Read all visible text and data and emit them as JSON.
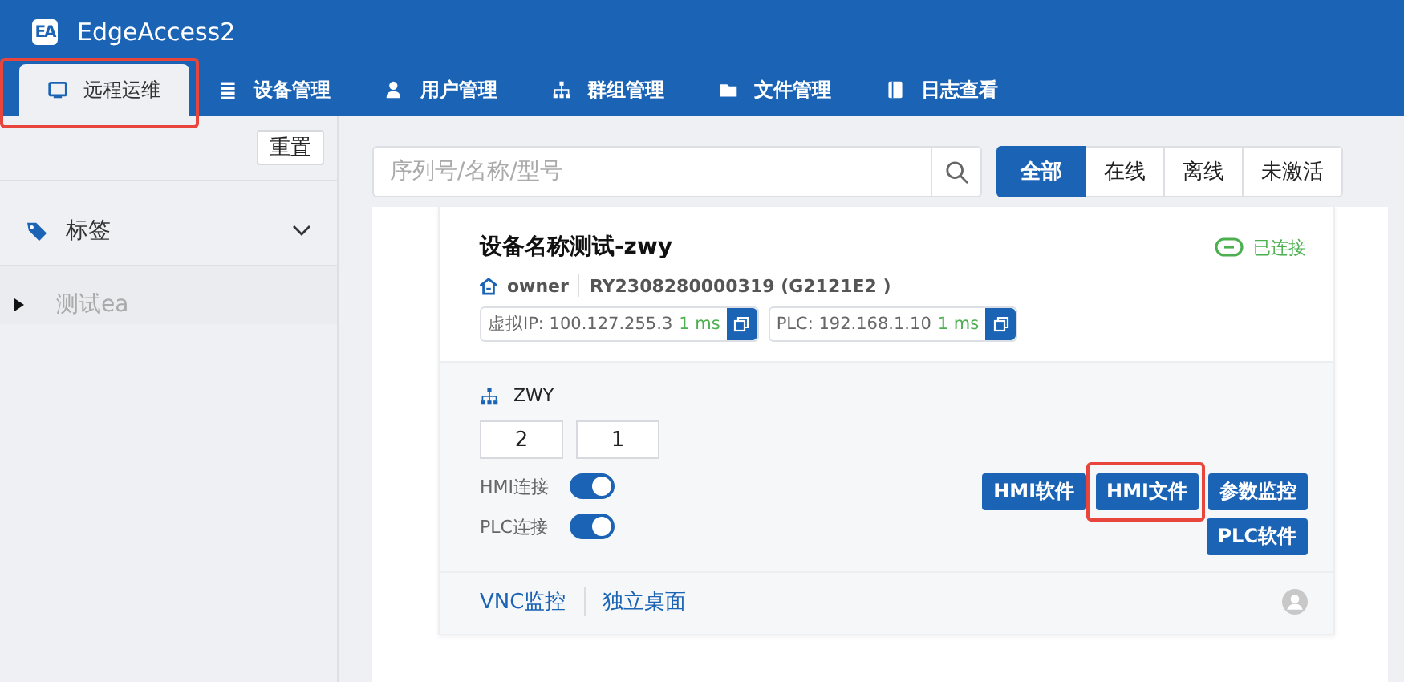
{
  "app": {
    "logo": "EA",
    "title": "EdgeAccess2"
  },
  "tabs": [
    {
      "label": "远程运维",
      "selected": true,
      "highlighted": true
    },
    {
      "label": "设备管理",
      "selected": false,
      "highlighted": false
    },
    {
      "label": "用户管理",
      "selected": false,
      "highlighted": false
    },
    {
      "label": "群组管理",
      "selected": false,
      "highlighted": false
    },
    {
      "label": "文件管理",
      "selected": false,
      "highlighted": false
    },
    {
      "label": "日志查看",
      "selected": false,
      "highlighted": false
    }
  ],
  "sidebar": {
    "reset": "重置",
    "tags_label": "标签",
    "expanded": false,
    "tree": [
      {
        "label": "测试ea",
        "expanded": false
      }
    ]
  },
  "search": {
    "placeholder": "序列号/名称/型号"
  },
  "filters": [
    {
      "label": "全部",
      "selected": true
    },
    {
      "label": "在线",
      "selected": false
    },
    {
      "label": "离线",
      "selected": false
    },
    {
      "label": "未激活",
      "selected": false
    }
  ],
  "device": {
    "name": "设备名称测试-zwy",
    "status": "已连接",
    "connected": true,
    "owner": "owner",
    "serial": "RY2308280000319 (G2121E2 )",
    "ips": [
      {
        "label": "虚拟IP: 100.127.255.3",
        "latency": "1 ms"
      },
      {
        "label": "PLC: 192.168.1.10",
        "latency": "1 ms"
      }
    ],
    "group": "ZWY",
    "counts": [
      "2",
      "1"
    ],
    "switches": [
      {
        "label": "HMI连接",
        "on": true
      },
      {
        "label": "PLC连接",
        "on": true
      }
    ],
    "buttons": [
      [
        {
          "label": "HMI软件",
          "highlighted": false
        },
        {
          "label": "HMI文件",
          "highlighted": true
        },
        {
          "label": "参数监控",
          "highlighted": false
        }
      ],
      [
        {
          "label": "PLC软件",
          "highlighted": false
        }
      ]
    ],
    "links": [
      "VNC监控",
      "独立桌面"
    ]
  }
}
